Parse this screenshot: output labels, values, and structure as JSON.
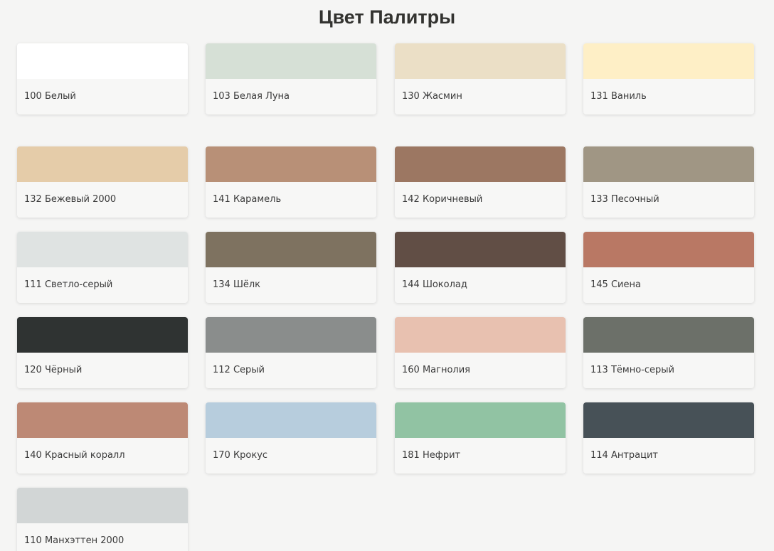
{
  "title": "Цвет Палитры",
  "swatches": [
    {
      "label": "100 Белый",
      "color": "#ffffff"
    },
    {
      "label": "103 Белая Луна",
      "color": "#d6e0d6"
    },
    {
      "label": "130 Жасмин",
      "color": "#ebdfc6"
    },
    {
      "label": "131 Ваниль",
      "color": "#feefc6"
    },
    {
      "label": "132 Бежевый 2000",
      "color": "#e5cca9"
    },
    {
      "label": "141 Карамель",
      "color": "#b89077"
    },
    {
      "label": "142 Коричневый",
      "color": "#9c7762"
    },
    {
      "label": "133 Песочный",
      "color": "#a09684"
    },
    {
      "label": "111 Светло-серый",
      "color": "#dfe3e2"
    },
    {
      "label": "134 Шёлк",
      "color": "#7e7260"
    },
    {
      "label": "144 Шоколад",
      "color": "#614e45"
    },
    {
      "label": "145 Сиена",
      "color": "#b97864"
    },
    {
      "label": "120 Чёрный",
      "color": "#2f3332"
    },
    {
      "label": "112 Серый",
      "color": "#8a8d8c"
    },
    {
      "label": "160 Магнолия",
      "color": "#e8c1b0"
    },
    {
      "label": "113 Тёмно-серый",
      "color": "#6c7069"
    },
    {
      "label": "140 Красный коралл",
      "color": "#bd8975"
    },
    {
      "label": "170 Крокус",
      "color": "#b7cddd"
    },
    {
      "label": "181 Нефрит",
      "color": "#91c3a3"
    },
    {
      "label": "114 Антрацит",
      "color": "#475157"
    },
    {
      "label": "110 Манхэттен 2000",
      "color": "#d2d6d6"
    }
  ]
}
